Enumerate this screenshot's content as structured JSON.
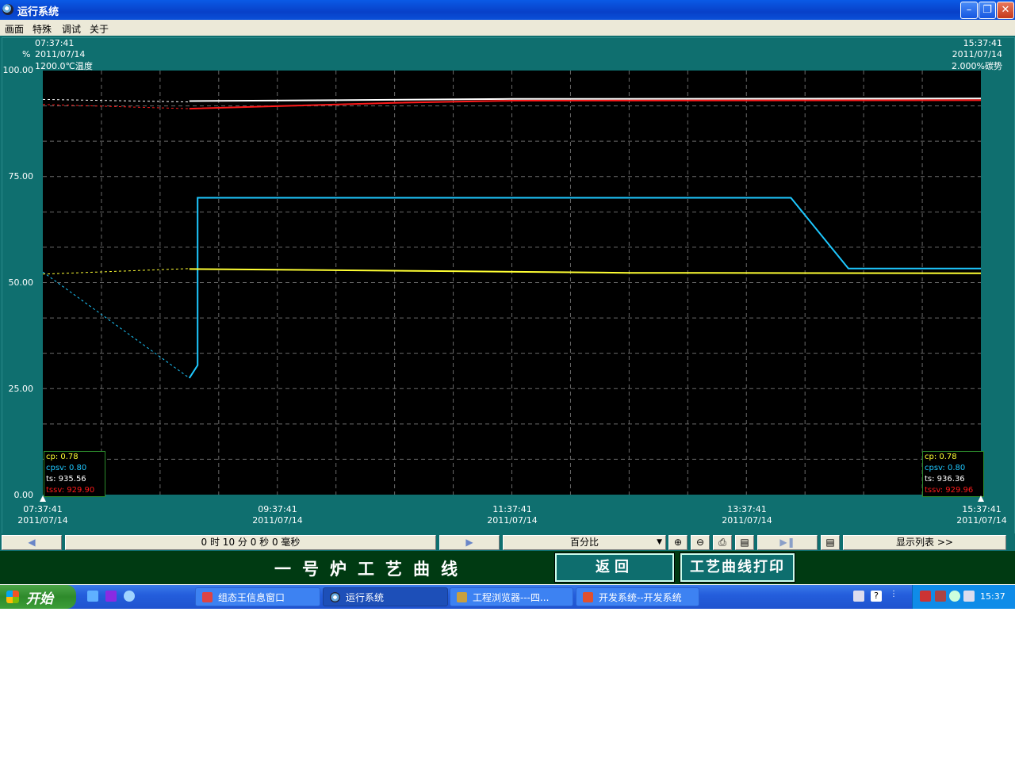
{
  "window": {
    "title": "运行系统"
  },
  "menu": [
    "画面",
    "特殊",
    "调试",
    "关于"
  ],
  "chart_header": {
    "left_time": "07:37:41",
    "left_date": "2011/07/14",
    "left_unit": "%",
    "left_scale": "1200.0℃温度",
    "right_time": "15:37:41",
    "right_date": "2011/07/14",
    "right_scale": "2.000%碳势"
  },
  "chart_data": {
    "type": "line",
    "title": "",
    "ylim": [
      0,
      100
    ],
    "y_ticks": [
      "100.00",
      "75.00",
      "50.00",
      "25.00",
      "0.00"
    ],
    "x_ticks": [
      {
        "time": "07:37:41",
        "date": "2011/07/14"
      },
      {
        "time": "09:37:41",
        "date": "2011/07/14"
      },
      {
        "time": "11:37:41",
        "date": "2011/07/14"
      },
      {
        "time": "13:37:41",
        "date": "2011/07/14"
      },
      {
        "time": "15:37:41",
        "date": "2011/07/14"
      }
    ],
    "x_range_hours": [
      0,
      8
    ],
    "grid": true,
    "series": [
      {
        "name": "ts",
        "color": "#ffffff",
        "dashed": [
          [
            0.0,
            93.2
          ],
          [
            1.25,
            92.6
          ]
        ],
        "solid": [
          [
            1.25,
            92.8
          ],
          [
            2.5,
            93.0
          ],
          [
            4.0,
            93.3
          ],
          [
            8.0,
            93.4
          ]
        ]
      },
      {
        "name": "tssv",
        "color": "#ff1a1a",
        "dashed": [
          [
            0.0,
            92.0
          ],
          [
            1.25,
            91.0
          ]
        ],
        "solid": [
          [
            1.25,
            91.0
          ],
          [
            2.0,
            91.6
          ],
          [
            3.0,
            92.4
          ],
          [
            4.0,
            92.9
          ],
          [
            8.0,
            93.0
          ]
        ]
      },
      {
        "name": "cpsv",
        "color": "#1ec8ff",
        "dashed": [
          [
            0.0,
            52.5
          ],
          [
            1.25,
            27.5
          ]
        ],
        "solid": [
          [
            1.25,
            27.5
          ],
          [
            1.32,
            30.5
          ],
          [
            1.32,
            70.0
          ],
          [
            6.38,
            70.0
          ],
          [
            6.87,
            53.3
          ],
          [
            8.0,
            53.3
          ]
        ]
      },
      {
        "name": "cp",
        "color": "#ffff33",
        "dashed": [
          [
            0.0,
            52.0
          ],
          [
            1.25,
            53.3
          ]
        ],
        "solid": [
          [
            1.25,
            53.2
          ],
          [
            3.5,
            52.7
          ],
          [
            5.0,
            52.3
          ],
          [
            8.0,
            52.2
          ]
        ]
      }
    ]
  },
  "legend_left": [
    {
      "label": "cp: 0.78",
      "color": "#ffff33"
    },
    {
      "label": "cpsv: 0.80",
      "color": "#1ec8ff"
    },
    {
      "label": "ts: 935.56",
      "color": "#ffffff"
    },
    {
      "label": "tssv: 929.90",
      "color": "#ff1a1a"
    }
  ],
  "legend_right": [
    {
      "label": "cp: 0.78",
      "color": "#ffff33"
    },
    {
      "label": "cpsv: 0.80",
      "color": "#1ec8ff"
    },
    {
      "label": "ts: 936.36",
      "color": "#ffffff"
    },
    {
      "label": "tssv: 929.96",
      "color": "#ff1a1a"
    }
  ],
  "toolbar": {
    "interval": "0 时 10 分 0 秒 0 毫秒",
    "scale_select": "百分比",
    "display_list": "显示列表 >>"
  },
  "banner": {
    "title": "一号炉工艺曲线",
    "back_button": "返回",
    "print_button": "工艺曲线打印"
  },
  "taskbar": {
    "start": "开始",
    "tasks": [
      "组态王信息窗口",
      "运行系统",
      "工程浏览器---四...",
      "开发系统--开发系统"
    ],
    "clock": "15:37"
  }
}
